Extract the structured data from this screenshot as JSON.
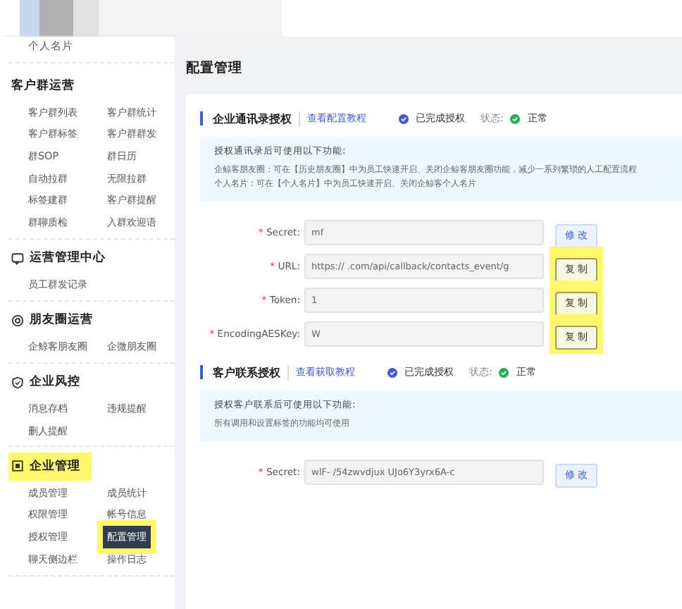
{
  "sidebar": {
    "top_item": "个人名片",
    "sections": [
      {
        "title": "客户群运营",
        "kind": "plain",
        "highlighted": false,
        "items": [
          {
            "label": "客户群列表",
            "selected": false
          },
          {
            "label": "客户群统计",
            "selected": false
          },
          {
            "label": "客户群标签",
            "selected": false
          },
          {
            "label": "客户群群发",
            "selected": false
          },
          {
            "label": "群SOP",
            "selected": false
          },
          {
            "label": "群日历",
            "selected": false
          },
          {
            "label": "自动拉群",
            "selected": false
          },
          {
            "label": "无限拉群",
            "selected": false
          },
          {
            "label": "标签建群",
            "selected": false
          },
          {
            "label": "客户群提醒",
            "selected": false
          },
          {
            "label": "群聊质检",
            "selected": false
          },
          {
            "label": "入群欢迎语",
            "selected": false
          }
        ]
      },
      {
        "title": "运营管理中心",
        "kind": "chat",
        "highlighted": false,
        "items": [
          {
            "label": "员工群发记录",
            "selected": false
          }
        ]
      },
      {
        "title": "朋友圈运营",
        "kind": "ring",
        "highlighted": false,
        "items": [
          {
            "label": "企鲸客朋友圈",
            "selected": false
          },
          {
            "label": "企微朋友圈",
            "selected": false
          }
        ]
      },
      {
        "title": "企业风控",
        "kind": "shield",
        "highlighted": false,
        "items": [
          {
            "label": "消息存档",
            "selected": false
          },
          {
            "label": "违规提醒",
            "selected": false
          },
          {
            "label": "删人提醒",
            "selected": false
          }
        ]
      },
      {
        "title": "企业管理",
        "kind": "building",
        "highlighted": true,
        "items": [
          {
            "label": "成员管理",
            "selected": false
          },
          {
            "label": "成员统计",
            "selected": false
          },
          {
            "label": "权限管理",
            "selected": false
          },
          {
            "label": "帐号信息",
            "selected": false
          },
          {
            "label": "授权管理",
            "selected": false
          },
          {
            "label": "配置管理",
            "selected": true
          },
          {
            "label": "聊天侧边栏",
            "selected": false
          },
          {
            "label": "操作日志",
            "selected": false
          }
        ]
      }
    ]
  },
  "page_title": "配置管理",
  "sections": [
    {
      "title": "企业通讯录授权",
      "link": "查看配置教程",
      "auth": "已完成授权",
      "status_label": "状态:",
      "status": "正常",
      "info_title": "授权通讯录后可使用以下功能:",
      "info_lines": [
        "企鲸客朋友圈：可在【历史朋友圈】中为员工快速开启、关闭企鲸客朋友圈功能，减少一系列繁琐的人工配置流程",
        "个人名片：可在【个人名片】中为员工快速开启、关闭企鲸客个人名片"
      ],
      "fields": [
        {
          "label": "Secret:",
          "mark": "*",
          "value": "mf",
          "button": "修 改",
          "kind": "edit",
          "highlighted": false
        },
        {
          "label": "URL:",
          "mark": "*",
          "value": "https:// .com/api/callback/contacts_event/g",
          "button": "复 制",
          "kind": "copy",
          "highlighted": true
        },
        {
          "label": "Token:",
          "mark": "*",
          "value": "1",
          "button": "复 制",
          "kind": "copy",
          "highlighted": true
        },
        {
          "label": "EncodingAESKey:",
          "mark": "*",
          "value": "W",
          "button": "复 制",
          "kind": "copy",
          "highlighted": true
        }
      ]
    },
    {
      "title": "客户联系授权",
      "link": "查看获取教程",
      "auth": "已完成授权",
      "status_label": "状态:",
      "status": "正常",
      "info_title": "授权客户联系后可使用以下功能:",
      "info_lines": [
        "所有调用和设置标签的功能均可使用"
      ],
      "fields": [
        {
          "label": "Secret:",
          "mark": "*",
          "value": "wlF- /54zwvdjux UJo6Y3yrx6A-c",
          "button": "修 改",
          "kind": "edit",
          "highlighted": false
        }
      ]
    }
  ]
}
